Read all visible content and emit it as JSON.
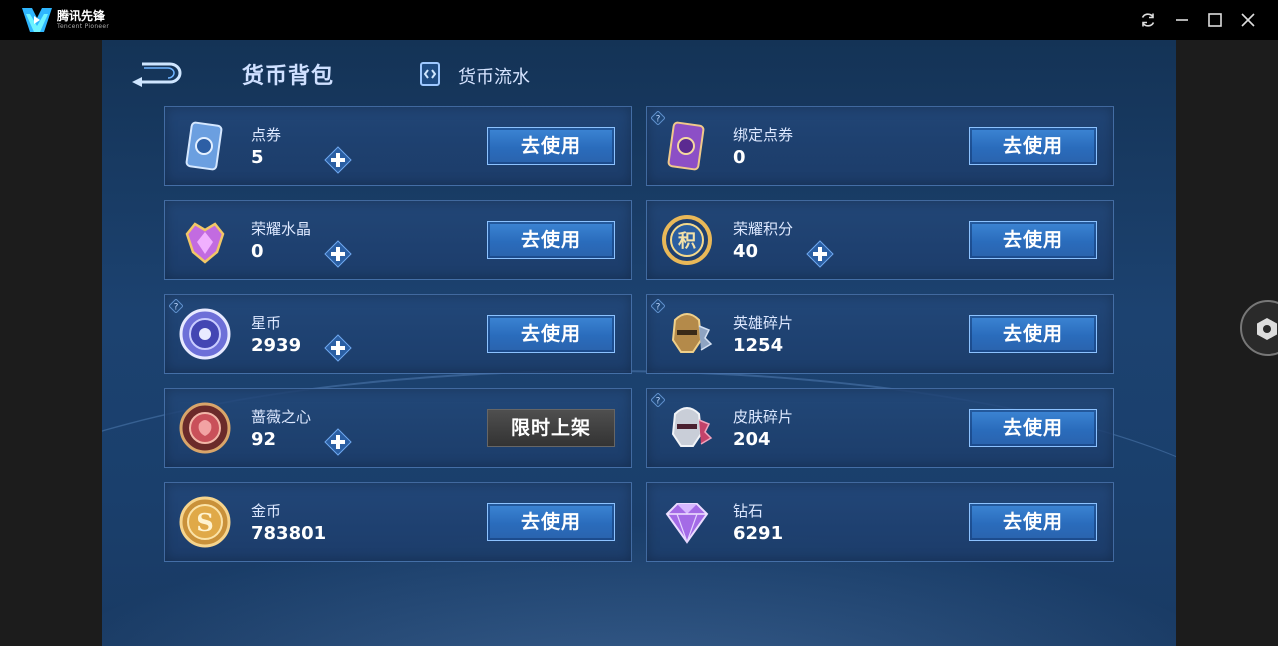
{
  "app": {
    "brand": "腾讯先锋",
    "brand_sub": "Tencent Pioneer"
  },
  "header": {
    "active_tab": "货币背包",
    "flow_tab": "货币流水"
  },
  "currencies": [
    {
      "name": "点券",
      "value": "5",
      "button": "去使用",
      "icon": "coupon-card-icon",
      "plus": true,
      "help": false
    },
    {
      "name": "绑定点券",
      "value": "0",
      "button": "去使用",
      "icon": "bound-coupon-card-icon",
      "plus": false,
      "help": true
    },
    {
      "name": "荣耀水晶",
      "value": "0",
      "button": "去使用",
      "icon": "glory-crystal-icon",
      "plus": true,
      "help": false
    },
    {
      "name": "荣耀积分",
      "value": "40",
      "button": "去使用",
      "icon": "glory-points-icon",
      "plus": true,
      "help": false
    },
    {
      "name": "星币",
      "value": "2939",
      "button": "去使用",
      "icon": "star-coin-icon",
      "plus": true,
      "help": true
    },
    {
      "name": "英雄碎片",
      "value": "1254",
      "button": "去使用",
      "icon": "hero-fragment-icon",
      "plus": false,
      "help": true
    },
    {
      "name": "蔷薇之心",
      "value": "92",
      "button": "限时上架",
      "icon": "rose-heart-icon",
      "plus": true,
      "help": false
    },
    {
      "name": "皮肤碎片",
      "value": "204",
      "button": "去使用",
      "icon": "skin-fragment-icon",
      "plus": false,
      "help": true
    },
    {
      "name": "金币",
      "value": "783801",
      "button": "去使用",
      "icon": "gold-coin-icon",
      "plus": false,
      "help": false
    },
    {
      "name": "钻石",
      "value": "6291",
      "button": "去使用",
      "icon": "diamond-icon",
      "plus": false,
      "help": false
    }
  ],
  "icons": {
    "glory_points_symbol": "积"
  },
  "colors": {
    "accent_button": "#2a6cbc",
    "background": "#1c4270",
    "limited_button": "#3f3f3f"
  }
}
